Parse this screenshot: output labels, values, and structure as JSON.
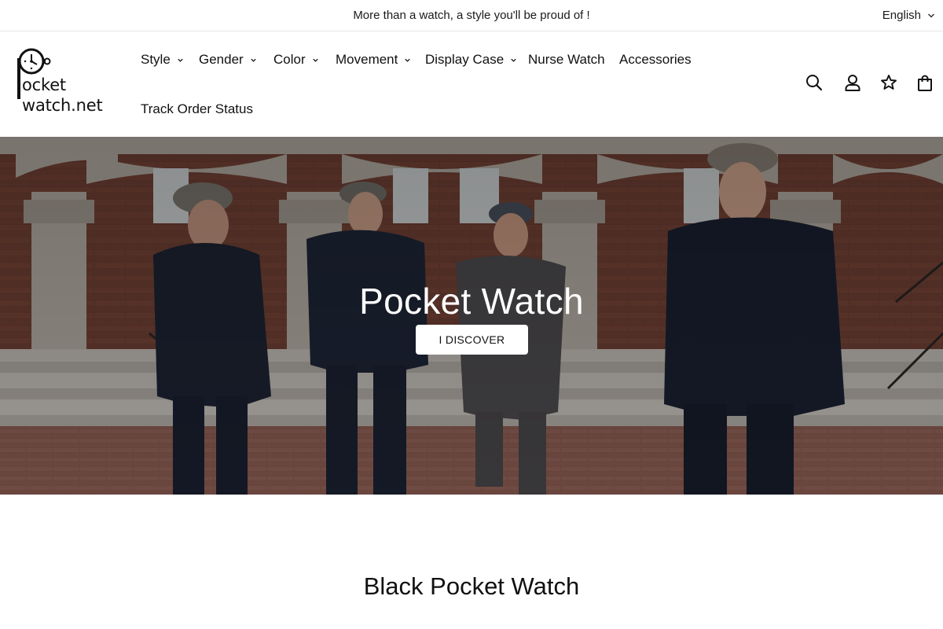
{
  "announcement": {
    "text": "More than a watch, a style you'll be proud of !",
    "language": "English"
  },
  "logo": {
    "line1": "ocket",
    "line2": "watch.net"
  },
  "nav": {
    "items": [
      {
        "label": "Style",
        "has_dropdown": true
      },
      {
        "label": "Gender",
        "has_dropdown": true
      },
      {
        "label": "Color",
        "has_dropdown": true
      },
      {
        "label": "Movement",
        "has_dropdown": true
      },
      {
        "label": "Display Case",
        "has_dropdown": true
      },
      {
        "label": "Nurse Watch",
        "has_dropdown": false
      },
      {
        "label": "Accessories",
        "has_dropdown": false
      },
      {
        "label": "Track Order Status",
        "has_dropdown": false
      }
    ]
  },
  "header_icons": [
    "search-icon",
    "account-icon",
    "wishlist-star-icon",
    "cart-bag-icon"
  ],
  "hero": {
    "title": "Pocket Watch",
    "button_label": "I DISCOVER"
  },
  "section": {
    "title": "Black Pocket Watch"
  },
  "colors": {
    "text": "#111111",
    "border": "#e6e6e6",
    "button_bg": "#ffffff",
    "hero_overlay_text": "#ffffff"
  }
}
